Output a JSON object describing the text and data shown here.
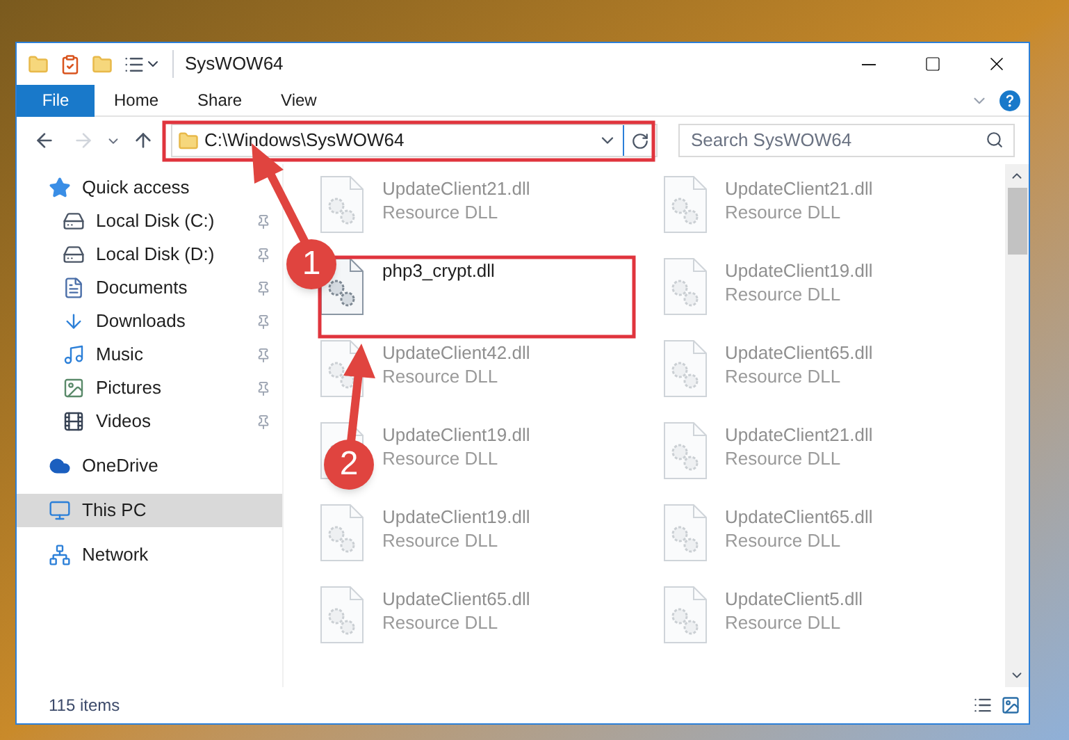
{
  "window": {
    "title": "SysWOW64"
  },
  "ribbon_tabs": [
    {
      "label": "File",
      "kind": "file"
    },
    {
      "label": "Home",
      "kind": "tab"
    },
    {
      "label": "Share",
      "kind": "tab"
    },
    {
      "label": "View",
      "kind": "tab"
    }
  ],
  "address_bar": {
    "path": "C:\\Windows\\SysWOW64"
  },
  "search": {
    "placeholder": "Search SysWOW64"
  },
  "sidebar": {
    "items": [
      {
        "label": "Quick access",
        "kind": "star",
        "pinned": false,
        "selected": false,
        "children": [
          {
            "label": "Local Disk (C:)",
            "kind": "drive",
            "pinned": true,
            "selected": false
          },
          {
            "label": "Local Disk (D:)",
            "kind": "drive",
            "pinned": true,
            "selected": false
          },
          {
            "label": "Documents",
            "kind": "document",
            "pinned": true,
            "selected": false
          },
          {
            "label": "Downloads",
            "kind": "download",
            "pinned": true,
            "selected": false
          },
          {
            "label": "Music",
            "kind": "music",
            "pinned": true,
            "selected": false
          },
          {
            "label": "Pictures",
            "kind": "picture",
            "pinned": true,
            "selected": false
          },
          {
            "label": "Videos",
            "kind": "video",
            "pinned": true,
            "selected": false
          }
        ]
      },
      {
        "label": "OneDrive",
        "kind": "cloud",
        "pinned": false,
        "selected": false
      },
      {
        "label": "This PC",
        "kind": "computer",
        "pinned": false,
        "selected": true
      },
      {
        "label": "Network",
        "kind": "network",
        "pinned": false,
        "selected": false
      }
    ]
  },
  "files": [
    {
      "name": "UpdateClient21.dll",
      "type": "Resource DLL",
      "blurred": true
    },
    {
      "name": "UpdateClient21.dll",
      "type": "Resource DLL",
      "blurred": true
    },
    {
      "name": "php3_crypt.dll",
      "blurred": false
    },
    {
      "name": "UpdateClient19.dll",
      "type": "Resource DLL",
      "blurred": true
    },
    {
      "name": "UpdateClient42.dll",
      "type": "Resource DLL",
      "blurred": true
    },
    {
      "name": "UpdateClient65.dll",
      "type": "Resource DLL",
      "blurred": true
    },
    {
      "name": "UpdateClient19.dll",
      "type": "Resource DLL",
      "blurred": true
    },
    {
      "name": "UpdateClient21.dll",
      "type": "Resource DLL",
      "blurred": true
    },
    {
      "name": "UpdateClient19.dll",
      "type": "Resource DLL",
      "blurred": true
    },
    {
      "name": "UpdateClient65.dll",
      "type": "Resource DLL",
      "blurred": true
    },
    {
      "name": "UpdateClient65.dll",
      "type": "Resource DLL",
      "blurred": true
    },
    {
      "name": "UpdateClient5.dll",
      "type": "Resource DLL",
      "blurred": true
    }
  ],
  "status_bar": {
    "count": "115 items"
  },
  "annotations": [
    {
      "number": "1"
    },
    {
      "number": "2"
    }
  ]
}
